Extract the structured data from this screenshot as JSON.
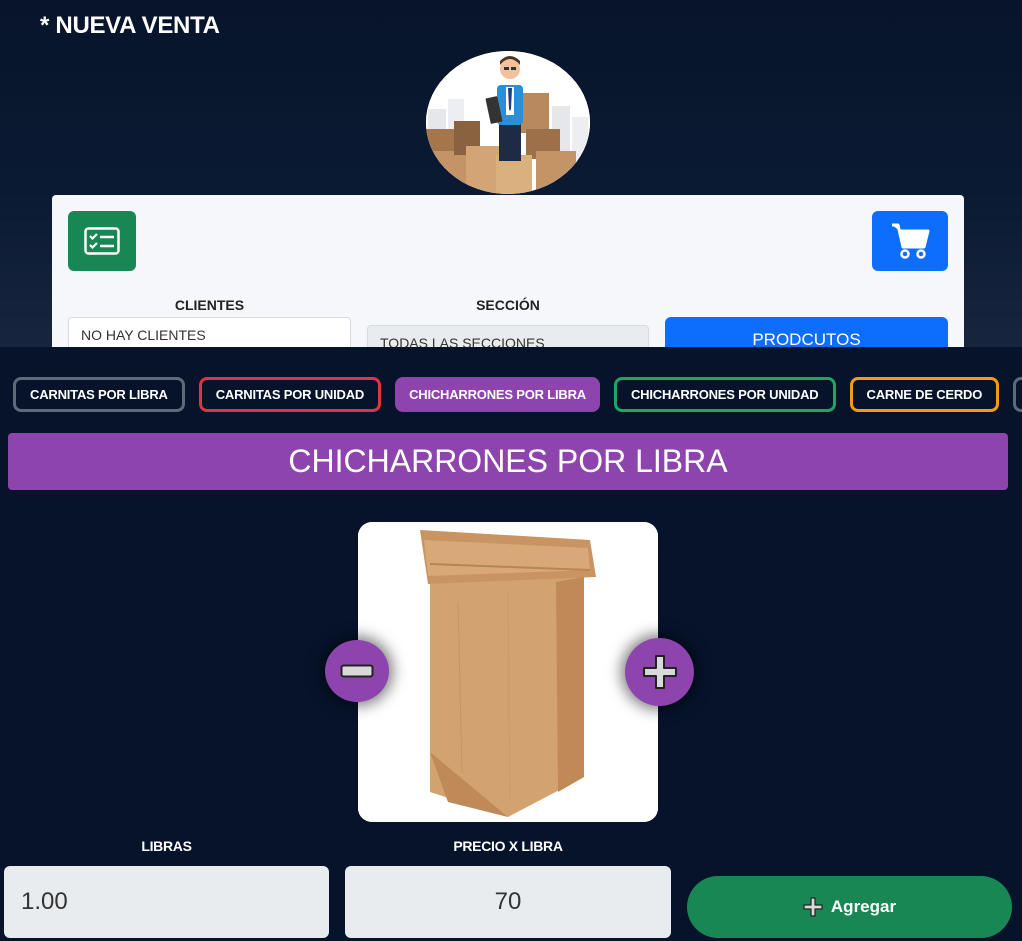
{
  "header": {
    "title": "* NUEVA VENTA"
  },
  "toolbar": {
    "list_icon": "checklist-icon",
    "cart_icon": "shopping-cart-icon"
  },
  "filters": {
    "clientes_label": "CLIENTES",
    "clientes_value": "NO HAY CLIENTES",
    "seccion_label": "SECCIÓN",
    "seccion_value": "TODAS LAS SECCIONES",
    "productos_button": "PRODCUTOS"
  },
  "categories": [
    {
      "label": "CARNITAS POR LIBRA",
      "color": "#5c6b7a",
      "active": false
    },
    {
      "label": "CARNITAS POR UNIDAD",
      "color": "#dc3545",
      "active": false
    },
    {
      "label": "CHICHARRONES POR LIBRA",
      "color": "#8e44ad",
      "active": true
    },
    {
      "label": "CHICHARRONES POR UNIDAD",
      "color": "#1fa463",
      "active": false
    },
    {
      "label": "CARNE DE CERDO",
      "color": "#f39c12",
      "active": false
    },
    {
      "label": "",
      "color": "#5c6b7a",
      "active": false
    }
  ],
  "selected_category": {
    "title": "CHICHARRONES POR LIBRA",
    "color": "#8e44ad"
  },
  "product": {
    "image": "paper-bag-image",
    "decrement_icon": "minus-icon",
    "increment_icon": "plus-icon"
  },
  "order": {
    "libras_label": "LIBRAS",
    "libras_value": "1.00",
    "precio_label": "PRECIO X LIBRA",
    "precio_value": "70",
    "add_button": "Agregar",
    "add_color": "#198754"
  },
  "colors": {
    "background": "#06132b",
    "accent_purple": "#8e44ad",
    "primary_blue": "#0d6efd",
    "success_green": "#198754"
  }
}
